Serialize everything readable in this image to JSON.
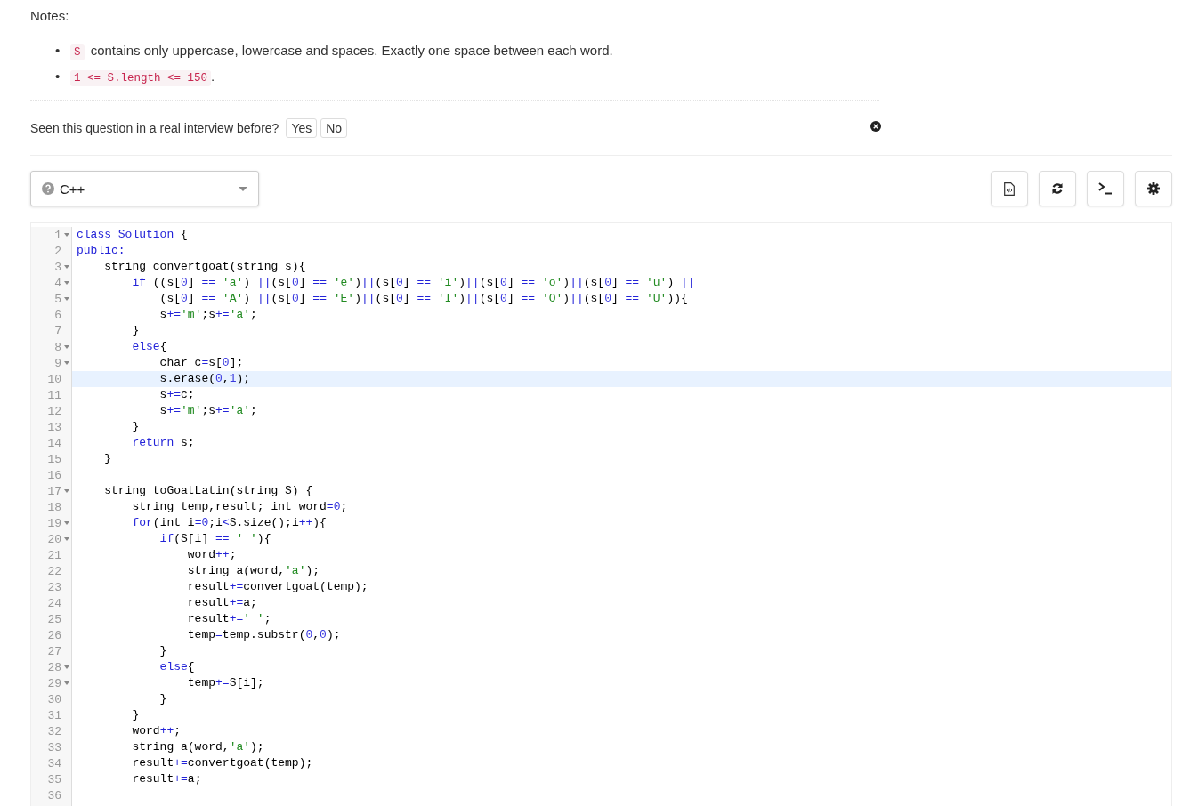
{
  "notes": {
    "title": "Notes:",
    "items": [
      {
        "bullet": "•",
        "code": "S",
        "text": " contains only uppercase, lowercase and spaces. Exactly one space between each word."
      },
      {
        "bullet": "•",
        "code": "1 <= S.length <= 150",
        "text": "."
      }
    ]
  },
  "feedback": {
    "question": "Seen this question in a real interview before?",
    "buttons": [
      "Yes",
      "No"
    ]
  },
  "language": {
    "label": "C++"
  },
  "editor": {
    "lines": [
      {
        "n": "1",
        "fold": true,
        "highlighted": false,
        "tokens": [
          {
            "kind": "k",
            "text": "class Solution"
          },
          {
            "kind": "p",
            "text": " {"
          }
        ]
      },
      {
        "n": "2",
        "fold": false,
        "highlighted": false,
        "tokens": [
          {
            "kind": "k",
            "text": "public:"
          }
        ]
      },
      {
        "n": "3",
        "fold": true,
        "highlighted": false,
        "tokens": [
          {
            "kind": "p",
            "text": "    string convertgoat(string s){"
          }
        ]
      },
      {
        "n": "4",
        "fold": true,
        "highlighted": false,
        "tokens": [
          {
            "kind": "k",
            "text": "        if"
          },
          {
            "kind": "p",
            "text": " ((s["
          },
          {
            "kind": "n",
            "text": "0"
          },
          {
            "kind": "p",
            "text": "] "
          },
          {
            "kind": "o",
            "text": "=="
          },
          {
            "kind": "s",
            "text": " 'a'"
          },
          {
            "kind": "p",
            "text": ") "
          },
          {
            "kind": "o",
            "text": "||"
          },
          {
            "kind": "p",
            "text": "(s["
          },
          {
            "kind": "n",
            "text": "0"
          },
          {
            "kind": "p",
            "text": "] "
          },
          {
            "kind": "o",
            "text": "=="
          },
          {
            "kind": "s",
            "text": " 'e'"
          },
          {
            "kind": "p",
            "text": ")"
          },
          {
            "kind": "o",
            "text": "||"
          },
          {
            "kind": "p",
            "text": "(s["
          },
          {
            "kind": "n",
            "text": "0"
          },
          {
            "kind": "p",
            "text": "] "
          },
          {
            "kind": "o",
            "text": "=="
          },
          {
            "kind": "s",
            "text": " 'i'"
          },
          {
            "kind": "p",
            "text": ")"
          },
          {
            "kind": "o",
            "text": "||"
          },
          {
            "kind": "p",
            "text": "(s["
          },
          {
            "kind": "n",
            "text": "0"
          },
          {
            "kind": "p",
            "text": "] "
          },
          {
            "kind": "o",
            "text": "=="
          },
          {
            "kind": "s",
            "text": " 'o'"
          },
          {
            "kind": "p",
            "text": ")"
          },
          {
            "kind": "o",
            "text": "||"
          },
          {
            "kind": "p",
            "text": "(s["
          },
          {
            "kind": "n",
            "text": "0"
          },
          {
            "kind": "p",
            "text": "] "
          },
          {
            "kind": "o",
            "text": "=="
          },
          {
            "kind": "s",
            "text": " 'u'"
          },
          {
            "kind": "p",
            "text": ") "
          },
          {
            "kind": "o",
            "text": "||"
          }
        ]
      },
      {
        "n": "5",
        "fold": true,
        "highlighted": false,
        "tokens": [
          {
            "kind": "p",
            "text": "            (s["
          },
          {
            "kind": "n",
            "text": "0"
          },
          {
            "kind": "p",
            "text": "] "
          },
          {
            "kind": "o",
            "text": "=="
          },
          {
            "kind": "s",
            "text": " 'A'"
          },
          {
            "kind": "p",
            "text": ") "
          },
          {
            "kind": "o",
            "text": "||"
          },
          {
            "kind": "p",
            "text": "(s["
          },
          {
            "kind": "n",
            "text": "0"
          },
          {
            "kind": "p",
            "text": "] "
          },
          {
            "kind": "o",
            "text": "=="
          },
          {
            "kind": "s",
            "text": " 'E'"
          },
          {
            "kind": "p",
            "text": ")"
          },
          {
            "kind": "o",
            "text": "||"
          },
          {
            "kind": "p",
            "text": "(s["
          },
          {
            "kind": "n",
            "text": "0"
          },
          {
            "kind": "p",
            "text": "] "
          },
          {
            "kind": "o",
            "text": "=="
          },
          {
            "kind": "s",
            "text": " 'I'"
          },
          {
            "kind": "p",
            "text": ")"
          },
          {
            "kind": "o",
            "text": "||"
          },
          {
            "kind": "p",
            "text": "(s["
          },
          {
            "kind": "n",
            "text": "0"
          },
          {
            "kind": "p",
            "text": "] "
          },
          {
            "kind": "o",
            "text": "=="
          },
          {
            "kind": "s",
            "text": " 'O'"
          },
          {
            "kind": "p",
            "text": ")"
          },
          {
            "kind": "o",
            "text": "||"
          },
          {
            "kind": "p",
            "text": "(s["
          },
          {
            "kind": "n",
            "text": "0"
          },
          {
            "kind": "p",
            "text": "] "
          },
          {
            "kind": "o",
            "text": "=="
          },
          {
            "kind": "s",
            "text": " 'U'"
          },
          {
            "kind": "p",
            "text": ")){"
          }
        ]
      },
      {
        "n": "6",
        "fold": false,
        "highlighted": false,
        "tokens": [
          {
            "kind": "p",
            "text": "            s"
          },
          {
            "kind": "o",
            "text": "+="
          },
          {
            "kind": "s",
            "text": "'m'"
          },
          {
            "kind": "p",
            "text": ";s"
          },
          {
            "kind": "o",
            "text": "+="
          },
          {
            "kind": "s",
            "text": "'a'"
          },
          {
            "kind": "p",
            "text": ";"
          }
        ]
      },
      {
        "n": "7",
        "fold": false,
        "highlighted": false,
        "tokens": [
          {
            "kind": "p",
            "text": "        }"
          }
        ]
      },
      {
        "n": "8",
        "fold": true,
        "highlighted": false,
        "tokens": [
          {
            "kind": "k",
            "text": "        else"
          },
          {
            "kind": "p",
            "text": "{"
          }
        ]
      },
      {
        "n": "9",
        "fold": true,
        "highlighted": false,
        "tokens": [
          {
            "kind": "p",
            "text": "            char c"
          },
          {
            "kind": "o",
            "text": "="
          },
          {
            "kind": "p",
            "text": "s["
          },
          {
            "kind": "n",
            "text": "0"
          },
          {
            "kind": "p",
            "text": "];"
          }
        ]
      },
      {
        "n": "10",
        "fold": false,
        "highlighted": true,
        "tokens": [
          {
            "kind": "p",
            "text": "            s.erase("
          },
          {
            "kind": "n",
            "text": "0"
          },
          {
            "kind": "p",
            "text": ","
          },
          {
            "kind": "n",
            "text": "1"
          },
          {
            "kind": "p",
            "text": ");"
          }
        ]
      },
      {
        "n": "11",
        "fold": false,
        "highlighted": false,
        "tokens": [
          {
            "kind": "p",
            "text": "            s"
          },
          {
            "kind": "o",
            "text": "+="
          },
          {
            "kind": "p",
            "text": "c;"
          }
        ]
      },
      {
        "n": "12",
        "fold": false,
        "highlighted": false,
        "tokens": [
          {
            "kind": "p",
            "text": "            s"
          },
          {
            "kind": "o",
            "text": "+="
          },
          {
            "kind": "s",
            "text": "'m'"
          },
          {
            "kind": "p",
            "text": ";s"
          },
          {
            "kind": "o",
            "text": "+="
          },
          {
            "kind": "s",
            "text": "'a'"
          },
          {
            "kind": "p",
            "text": ";"
          }
        ]
      },
      {
        "n": "13",
        "fold": false,
        "highlighted": false,
        "tokens": [
          {
            "kind": "p",
            "text": "        }"
          }
        ]
      },
      {
        "n": "14",
        "fold": false,
        "highlighted": false,
        "tokens": [
          {
            "kind": "k",
            "text": "        return"
          },
          {
            "kind": "p",
            "text": " s;"
          }
        ]
      },
      {
        "n": "15",
        "fold": false,
        "highlighted": false,
        "tokens": [
          {
            "kind": "p",
            "text": "    }"
          }
        ]
      },
      {
        "n": "16",
        "fold": false,
        "highlighted": false
      },
      {
        "n": "17",
        "fold": true,
        "highlighted": false,
        "tokens": [
          {
            "kind": "p",
            "text": "    string toGoatLatin(string S) {"
          }
        ]
      },
      {
        "n": "18",
        "fold": false,
        "highlighted": false,
        "tokens": [
          {
            "kind": "p",
            "text": "        string temp,result; int word"
          },
          {
            "kind": "o",
            "text": "="
          },
          {
            "kind": "n",
            "text": "0"
          },
          {
            "kind": "p",
            "text": ";"
          }
        ]
      },
      {
        "n": "19",
        "fold": true,
        "highlighted": false,
        "tokens": [
          {
            "kind": "k",
            "text": "        for"
          },
          {
            "kind": "p",
            "text": "(int i"
          },
          {
            "kind": "o",
            "text": "="
          },
          {
            "kind": "n",
            "text": "0"
          },
          {
            "kind": "p",
            "text": ";i"
          },
          {
            "kind": "o",
            "text": "<"
          },
          {
            "kind": "p",
            "text": "S.size();i"
          },
          {
            "kind": "o",
            "text": "++"
          },
          {
            "kind": "p",
            "text": "){"
          }
        ]
      },
      {
        "n": "20",
        "fold": true,
        "highlighted": false,
        "tokens": [
          {
            "kind": "k",
            "text": "            if"
          },
          {
            "kind": "p",
            "text": "(S[i] "
          },
          {
            "kind": "o",
            "text": "=="
          },
          {
            "kind": "s",
            "text": " ' '"
          },
          {
            "kind": "p",
            "text": "){"
          }
        ]
      },
      {
        "n": "21",
        "fold": false,
        "highlighted": false,
        "tokens": [
          {
            "kind": "p",
            "text": "                word"
          },
          {
            "kind": "o",
            "text": "++"
          },
          {
            "kind": "p",
            "text": ";"
          }
        ]
      },
      {
        "n": "22",
        "fold": false,
        "highlighted": false,
        "tokens": [
          {
            "kind": "p",
            "text": "                string a(word,"
          },
          {
            "kind": "s",
            "text": "'a'"
          },
          {
            "kind": "p",
            "text": ");"
          }
        ]
      },
      {
        "n": "23",
        "fold": false,
        "highlighted": false,
        "tokens": [
          {
            "kind": "p",
            "text": "                result"
          },
          {
            "kind": "o",
            "text": "+="
          },
          {
            "kind": "p",
            "text": "convertgoat(temp);"
          }
        ]
      },
      {
        "n": "24",
        "fold": false,
        "highlighted": false,
        "tokens": [
          {
            "kind": "p",
            "text": "                result"
          },
          {
            "kind": "o",
            "text": "+="
          },
          {
            "kind": "p",
            "text": "a;"
          }
        ]
      },
      {
        "n": "25",
        "fold": false,
        "highlighted": false,
        "tokens": [
          {
            "kind": "p",
            "text": "                result"
          },
          {
            "kind": "o",
            "text": "+="
          },
          {
            "kind": "s",
            "text": "' '"
          },
          {
            "kind": "p",
            "text": ";"
          }
        ]
      },
      {
        "n": "26",
        "fold": false,
        "highlighted": false,
        "tokens": [
          {
            "kind": "p",
            "text": "                temp"
          },
          {
            "kind": "o",
            "text": "="
          },
          {
            "kind": "p",
            "text": "temp.substr("
          },
          {
            "kind": "n",
            "text": "0"
          },
          {
            "kind": "p",
            "text": ","
          },
          {
            "kind": "n",
            "text": "0"
          },
          {
            "kind": "p",
            "text": ");"
          }
        ]
      },
      {
        "n": "27",
        "fold": false,
        "highlighted": false,
        "tokens": [
          {
            "kind": "p",
            "text": "            }"
          }
        ]
      },
      {
        "n": "28",
        "fold": true,
        "highlighted": false,
        "tokens": [
          {
            "kind": "k",
            "text": "            else"
          },
          {
            "kind": "p",
            "text": "{"
          }
        ]
      },
      {
        "n": "29",
        "fold": true,
        "highlighted": false,
        "tokens": [
          {
            "kind": "p",
            "text": "                temp"
          },
          {
            "kind": "o",
            "text": "+="
          },
          {
            "kind": "p",
            "text": "S[i];"
          }
        ]
      },
      {
        "n": "30",
        "fold": false,
        "highlighted": false,
        "tokens": [
          {
            "kind": "p",
            "text": "            }"
          }
        ]
      },
      {
        "n": "31",
        "fold": false,
        "highlighted": false,
        "tokens": [
          {
            "kind": "p",
            "text": "        }"
          }
        ]
      },
      {
        "n": "32",
        "fold": false,
        "highlighted": false,
        "tokens": [
          {
            "kind": "p",
            "text": "        word"
          },
          {
            "kind": "o",
            "text": "++"
          },
          {
            "kind": "p",
            "text": ";"
          }
        ]
      },
      {
        "n": "33",
        "fold": false,
        "highlighted": false,
        "tokens": [
          {
            "kind": "p",
            "text": "        string a(word,"
          },
          {
            "kind": "s",
            "text": "'a'"
          },
          {
            "kind": "p",
            "text": ");"
          }
        ]
      },
      {
        "n": "34",
        "fold": false,
        "highlighted": false,
        "tokens": [
          {
            "kind": "p",
            "text": "        result"
          },
          {
            "kind": "o",
            "text": "+="
          },
          {
            "kind": "p",
            "text": "convertgoat(temp);"
          }
        ]
      },
      {
        "n": "35",
        "fold": false,
        "highlighted": false,
        "tokens": [
          {
            "kind": "p",
            "text": "        result"
          },
          {
            "kind": "o",
            "text": "+="
          },
          {
            "kind": "p",
            "text": "a;"
          }
        ]
      },
      {
        "n": "36",
        "fold": false,
        "highlighted": false
      }
    ]
  }
}
